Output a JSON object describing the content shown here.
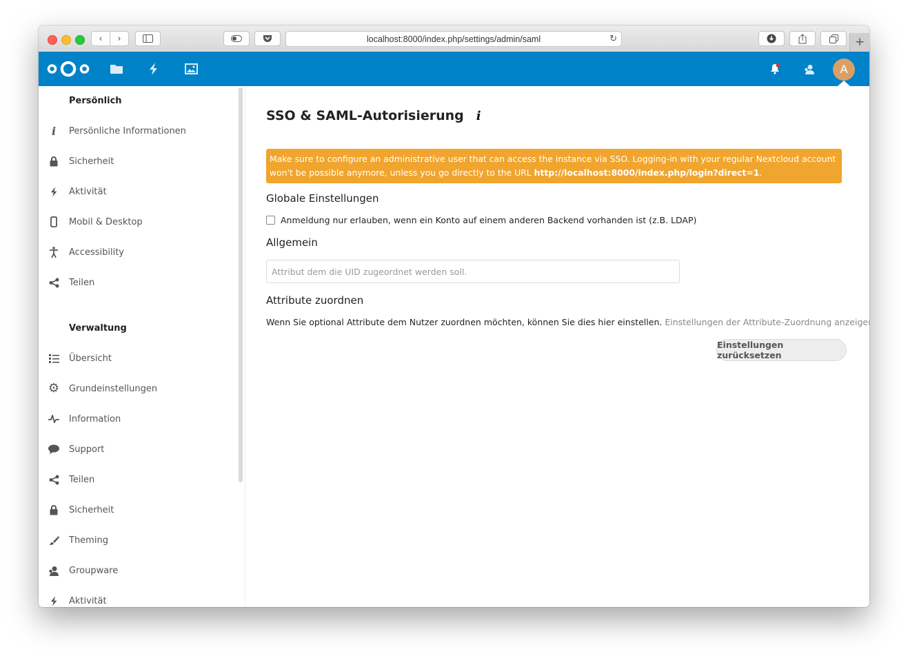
{
  "browser": {
    "url": "localhost:8000/index.php/settings/admin/saml"
  },
  "header": {
    "apps": [
      "files-icon",
      "activity-icon",
      "gallery-icon"
    ],
    "avatar_letter": "A",
    "brand_color": "#0082c9",
    "avatar_color": "#d9a066"
  },
  "sidebar": {
    "personal_heading": "Persönlich",
    "personal_items": [
      {
        "label": "Persönliche Informationen",
        "icon": "info-icon"
      },
      {
        "label": "Sicherheit",
        "icon": "lock-icon"
      },
      {
        "label": "Aktivität",
        "icon": "activity-icon"
      },
      {
        "label": "Mobil & Desktop",
        "icon": "phone-icon"
      },
      {
        "label": "Accessibility",
        "icon": "accessibility-icon"
      },
      {
        "label": "Teilen",
        "icon": "share-icon"
      }
    ],
    "admin_heading": "Verwaltung",
    "admin_items": [
      {
        "label": "Übersicht",
        "icon": "list-icon"
      },
      {
        "label": "Grundeinstellungen",
        "icon": "gear-icon"
      },
      {
        "label": "Information",
        "icon": "pulse-icon"
      },
      {
        "label": "Support",
        "icon": "speech-bubble-icon"
      },
      {
        "label": "Teilen",
        "icon": "share-icon"
      },
      {
        "label": "Sicherheit",
        "icon": "lock-icon"
      },
      {
        "label": "Theming",
        "icon": "brush-icon"
      },
      {
        "label": "Groupware",
        "icon": "contacts-icon"
      },
      {
        "label": "Aktivität",
        "icon": "activity-icon"
      }
    ]
  },
  "main": {
    "title": "SSO & SAML-Autorisierung",
    "info_glyph": "i",
    "warning_text": "Make sure to configure an administrative user that can access the instance via SSO. Logging-in with your regular Nextcloud account won't be possible anymore, unless you go directly to the URL ",
    "warning_url": "http://localhost:8000/index.php/login?direct=1",
    "warning_end": ".",
    "warning_color": "#f0a52e",
    "global_heading": "Globale Einstellungen",
    "checkbox_label": "Anmeldung nur erlauben, wenn ein Konto auf einem anderen Backend vorhanden ist (z.B. LDAP)",
    "general_heading": "Allgemein",
    "uid_placeholder": "Attribut dem die UID zugeordnet werden soll.",
    "attr_heading": "Attribute zuordnen",
    "attr_description": "Wenn Sie optional Attribute dem Nutzer zuordnen möchten, können Sie dies hier einstellen.",
    "attr_link": "Einstellungen der Attribute-Zuordnung anzeigen…",
    "reset_label": "Einstellungen zurücksetzen"
  }
}
